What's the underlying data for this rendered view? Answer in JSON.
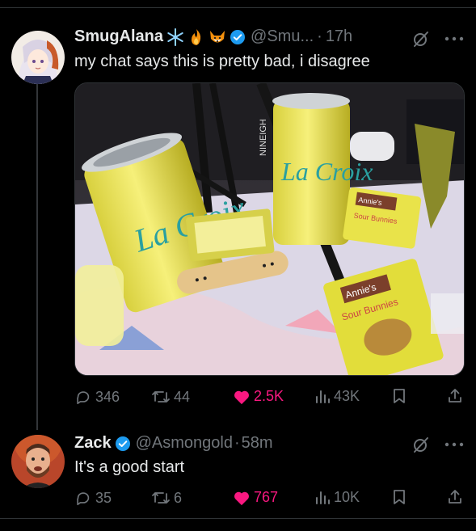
{
  "tweet": {
    "author_name": "SmugAlana",
    "badges": [
      "snowflake-emoji",
      "fire-emoji",
      "fox-emoji"
    ],
    "handle": "@Smu...",
    "dot": "·",
    "time": "17h",
    "text": "my chat says this is pretty bad, i disagree",
    "media": {
      "can_brand_1": "La Croix",
      "can_brand_2": "La Croix",
      "pouch_brand_1": "Annie's",
      "pouch_label_1": "Sour Bunnies",
      "pouch_brand_2": "Annie's",
      "pouch_label_2": "Sour Bunnies",
      "stand_label": "NINEIGH"
    },
    "stats": {
      "replies": "346",
      "reposts": "44",
      "likes": "2.5K",
      "views": "43K"
    }
  },
  "reply": {
    "author_name": "Zack",
    "handle": "@Asmongold",
    "dot": "·",
    "time": "58m",
    "text": "It's a good start",
    "stats": {
      "replies": "35",
      "reposts": "6",
      "likes": "767",
      "views": "10K"
    }
  },
  "colors": {
    "background": "#000000",
    "text": "#e7e9ea",
    "muted": "#71767b",
    "verified": "#1d9bf0",
    "like": "#f91880"
  }
}
